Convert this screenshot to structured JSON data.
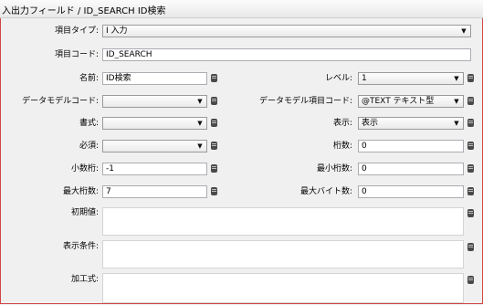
{
  "title": "入出力フィールド / ID_SEARCH ID検索",
  "fields": {
    "item_type": {
      "label": "項目タイプ:",
      "value": "I 入力"
    },
    "item_code": {
      "label": "項目コード:",
      "value": "ID_SEARCH"
    },
    "name": {
      "label": "名前:",
      "value": "ID検索"
    },
    "level": {
      "label": "レベル:",
      "value": "1"
    },
    "data_model_code": {
      "label": "データモデルコード:",
      "value": ""
    },
    "data_model_item_code": {
      "label": "データモデル項目コード:",
      "value": "@TEXT テキスト型"
    },
    "format": {
      "label": "書式:",
      "value": ""
    },
    "display": {
      "label": "表示:",
      "value": "表示"
    },
    "required": {
      "label": "必須:",
      "value": ""
    },
    "digits": {
      "label": "桁数:",
      "value": "0"
    },
    "decimal_digits": {
      "label": "小数桁:",
      "value": "-1"
    },
    "min_digits": {
      "label": "最小桁数:",
      "value": "0"
    },
    "max_digits": {
      "label": "最大桁数:",
      "value": "7"
    },
    "max_bytes": {
      "label": "最大バイト数:",
      "value": "0"
    },
    "initial_value": {
      "label": "初期値:",
      "value": ""
    },
    "display_condition": {
      "label": "表示条件:",
      "value": ""
    },
    "processing_formula": {
      "label": "加工式:",
      "value": ""
    }
  },
  "icons": {
    "dropdown": "chevron-down-icon",
    "database": "database-icon"
  }
}
